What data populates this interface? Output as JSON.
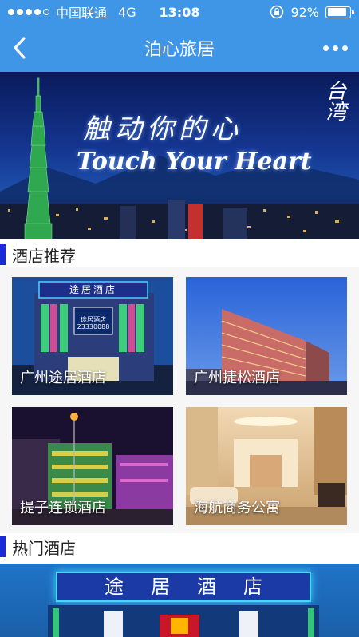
{
  "status_bar": {
    "carrier": "中国联通",
    "network": "4G",
    "time": "13:08",
    "battery_text": "92%",
    "battery_level": 0.92,
    "signal_bars_filled": 4,
    "signal_bars_total": 5,
    "icons": [
      "orientation-lock-icon",
      "battery-icon"
    ]
  },
  "nav": {
    "title": "泊心旅居",
    "back_icon": "chevron-left-icon",
    "more_icon": "more-horizontal-icon"
  },
  "banner": {
    "text_cn": "触动你的心",
    "text_en": "Touch Your Heart",
    "text_tw": "台湾"
  },
  "sections": {
    "recommended": "酒店推荐",
    "popular": "热门酒店"
  },
  "recommended_hotels": [
    {
      "name": "广州途居酒店",
      "sign": "途居酒店",
      "sign_sub": "途居酒店",
      "phone": "23330088"
    },
    {
      "name": "广州捷松酒店"
    },
    {
      "name": "提子连锁酒店"
    },
    {
      "name": "海航商务公寓"
    }
  ],
  "popular_hotels": [
    {
      "sign": "途居酒店"
    }
  ],
  "colors": {
    "header": "#3f96e7",
    "section_accent": "#1a2bd8"
  }
}
